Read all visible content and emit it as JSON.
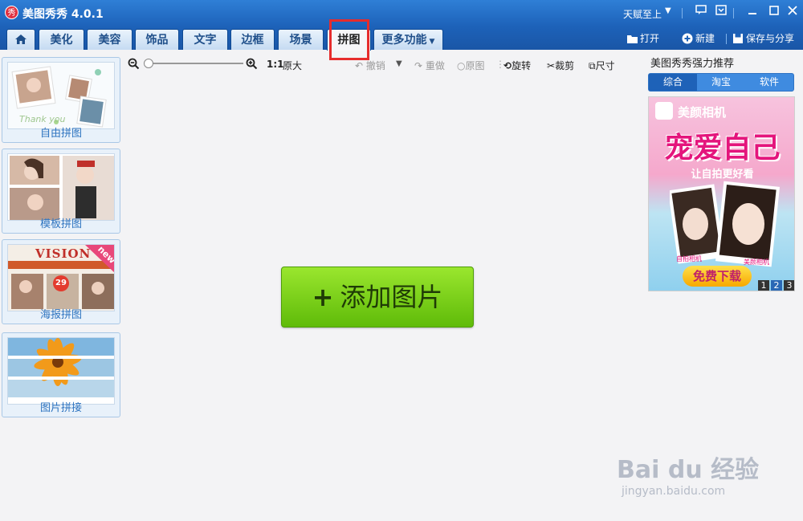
{
  "window": {
    "title": "美图秀秀 4.0.1",
    "logo_text": "秀",
    "user": "天赋至上"
  },
  "tabs": [
    {
      "label": ""
    },
    {
      "label": "美化"
    },
    {
      "label": "美容"
    },
    {
      "label": "饰品"
    },
    {
      "label": "文字"
    },
    {
      "label": "边框"
    },
    {
      "label": "场景"
    },
    {
      "label": "拼图"
    },
    {
      "label": "更多功能"
    }
  ],
  "top_actions": {
    "open": "打开",
    "new": "新建",
    "save_share": "保存与分享"
  },
  "left_panel": {
    "items": [
      {
        "label": "自由拼图"
      },
      {
        "label": "模板拼图"
      },
      {
        "label": "海报拼图",
        "badge": "new",
        "poster_title": "VISION",
        "poster_number": "29"
      },
      {
        "label": "图片拼接"
      }
    ],
    "free_thumb_text": "Thank you"
  },
  "edit_toolbar": {
    "ratio": "1:1",
    "original_size": "原大",
    "undo": "撤销",
    "redo": "重做",
    "original": "原图",
    "rotate": "旋转",
    "crop": "裁剪",
    "resize": "尺寸"
  },
  "canvas": {
    "add_button": "添加图片"
  },
  "recommend": {
    "title": "美图秀秀强力推荐",
    "tabs": [
      "综合",
      "淘宝",
      "软件"
    ],
    "ad": {
      "brand": "美颜相机",
      "slogan": "宠爱自己",
      "sub": "让自拍更好看",
      "tag1": "自拍相机",
      "tag2": "美颜相机",
      "download": "免费下载",
      "pages": [
        "1",
        "2",
        "3"
      ]
    }
  },
  "watermark": {
    "line1": "Bai du 经验",
    "line2": "jingyan.baidu.com"
  },
  "colors": {
    "titlebar": "#1d62b9",
    "highlight": "#e62c2c",
    "add_button": "#7fd21b",
    "left_label": "#2e74c0"
  }
}
